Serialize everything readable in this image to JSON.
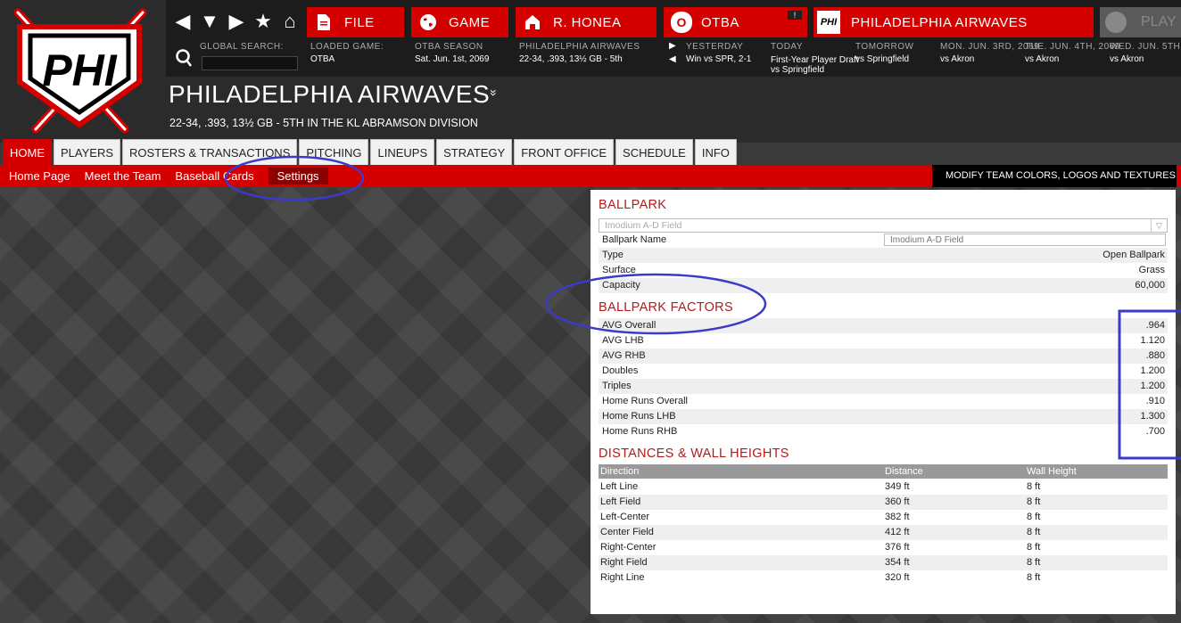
{
  "colors": {
    "brand_red": "#d40000",
    "dark": "#2b2b2b",
    "section_red": "#b01c1c",
    "annotation_blue": "#3b3bc8"
  },
  "logo": {
    "text": "PHI"
  },
  "nav": {
    "icons": [
      "back-icon",
      "dropdown-icon",
      "forward-icon",
      "star-icon",
      "home-icon"
    ]
  },
  "menu": {
    "file": "FILE",
    "game": "GAME",
    "manager": "R. HONEA",
    "league": "OTBA",
    "team": "PHILADELPHIA AIRWAVES",
    "play": "PLAY",
    "league_logo": "O",
    "team_logo": "PHI",
    "alert": "!"
  },
  "search": {
    "label": "GLOBAL SEARCH:",
    "value": ""
  },
  "info": {
    "loaded_game_label": "LOADED GAME:",
    "loaded_game": "OTBA",
    "season_label": "OTBA SEASON",
    "season": "Sat. Jun. 1st, 2069",
    "team_label": "PHILADELPHIA AIRWAVES",
    "team_record": "22-34, .393, 13½ GB - 5th",
    "yesterday_label": "YESTERDAY",
    "yesterday": "Win vs SPR, 2-1",
    "today_label": "TODAY",
    "today": "First-Year Player Draft",
    "today2": "vs Springfield",
    "tomorrow_label": "TOMORROW",
    "tomorrow": "vs Springfield",
    "d3_label": "MON. JUN. 3RD, 2069",
    "d3": "vs Akron",
    "d4_label": "TUE. JUN. 4TH, 2069",
    "d4": "vs Akron",
    "d5_label": "WED. JUN. 5TH,",
    "d5": "vs Akron"
  },
  "header": {
    "title": "PHILADELPHIA AIRWAVES",
    "subtitle": "22-34, .393, 13½ GB - 5TH IN THE KL ABRAMSON DIVISION",
    "expand_glyph": "»"
  },
  "tabs": [
    "HOME",
    "PLAYERS",
    "ROSTERS & TRANSACTIONS",
    "PITCHING",
    "LINEUPS",
    "STRATEGY",
    "FRONT OFFICE",
    "SCHEDULE",
    "INFO"
  ],
  "subnav": {
    "items": [
      "Home Page",
      "Meet the Team",
      "Baseball Cards",
      "Settings"
    ],
    "modify": "MODIFY TEAM COLORS, LOGOS AND TEXTURES"
  },
  "ballpark": {
    "heading": "BALLPARK",
    "select": "Imodium A-D Field",
    "name_label": "Ballpark Name",
    "name_placeholder": "Imodium A-D Field",
    "type_label": "Type",
    "type": "Open Ballpark",
    "surface_label": "Surface",
    "surface": "Grass",
    "capacity_label": "Capacity",
    "capacity": "60,000"
  },
  "factors": {
    "heading": "BALLPARK FACTORS",
    "rows": [
      {
        "label": "AVG Overall",
        "value": ".964"
      },
      {
        "label": "AVG LHB",
        "value": "1.120"
      },
      {
        "label": "AVG RHB",
        "value": ".880"
      },
      {
        "label": "Doubles",
        "value": "1.200"
      },
      {
        "label": "Triples",
        "value": "1.200"
      },
      {
        "label": "Home Runs Overall",
        "value": ".910"
      },
      {
        "label": "Home Runs LHB",
        "value": "1.300"
      },
      {
        "label": "Home Runs RHB",
        "value": ".700"
      }
    ]
  },
  "distances": {
    "heading": "DISTANCES & WALL HEIGHTS",
    "columns": [
      "Direction",
      "Distance",
      "Wall Height"
    ],
    "rows": [
      [
        "Left Line",
        "349 ft",
        "8 ft"
      ],
      [
        "Left Field",
        "360 ft",
        "8 ft"
      ],
      [
        "Left-Center",
        "382 ft",
        "8 ft"
      ],
      [
        "Center Field",
        "412 ft",
        "8 ft"
      ],
      [
        "Right-Center",
        "376 ft",
        "8 ft"
      ],
      [
        "Right Field",
        "354 ft",
        "8 ft"
      ],
      [
        "Right Line",
        "320 ft",
        "8 ft"
      ]
    ]
  }
}
